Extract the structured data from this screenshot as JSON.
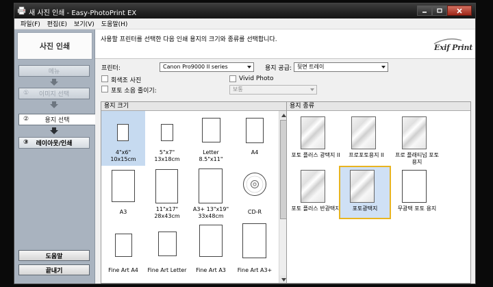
{
  "window": {
    "title": "새 사진 인쇄 - Easy-PhotoPrint EX",
    "app_icon": "printer-app-icon"
  },
  "menu": [
    "파일(F)",
    "편집(E)",
    "보기(V)",
    "도움말(H)"
  ],
  "nav": {
    "title": "사진 인쇄",
    "steps": [
      {
        "label": "메뉴",
        "num": "",
        "state": "disabled"
      },
      {
        "label": "이미지 선택",
        "num": "①",
        "state": "disabled"
      },
      {
        "label": "용지 선택",
        "num": "②",
        "state": "active"
      },
      {
        "label": "레이아웃/인쇄",
        "num": "③",
        "state": "enabled"
      }
    ],
    "help_label": "도움말",
    "exit_label": "끝내기"
  },
  "instruction": {
    "text": "사용할 프린터를 선택한 다음 인쇄 용지의 크기와 종류를 선택합니다.",
    "logo": "Exif Print"
  },
  "settings": {
    "printer_label": "프린터:",
    "printer_value": "Canon Pro9000 II series",
    "paper_source_label": "용지 공급:",
    "paper_source_value": "뒷면 트레이",
    "grayscale_label": "회색조 사진",
    "vivid_label": "Vivid Photo",
    "noise_label": "포토 소음 줄이기:",
    "noise_value": "보통"
  },
  "paper_size": {
    "header": "용지 크기",
    "items": [
      {
        "label1": "4\"x6\"",
        "label2": "10x15cm",
        "selected": true
      },
      {
        "label1": "5\"x7\"",
        "label2": "13x18cm",
        "selected": false
      },
      {
        "label1": "Letter",
        "label2": "8.5\"x11\"",
        "selected": false
      },
      {
        "label1": "A4",
        "label2": "",
        "selected": false
      },
      {
        "label1": "A3",
        "label2": "",
        "selected": false
      },
      {
        "label1": "11\"x17\"",
        "label2": "28x43cm",
        "selected": false
      },
      {
        "label1": "A3+ 13\"x19\"",
        "label2": "33x48cm",
        "selected": false
      },
      {
        "label1": "CD-R",
        "label2": "",
        "selected": false
      },
      {
        "label1": "Fine Art A4",
        "label2": "",
        "selected": false
      },
      {
        "label1": "Fine Art Letter",
        "label2": "",
        "selected": false
      },
      {
        "label1": "Fine Art A3",
        "label2": "",
        "selected": false
      },
      {
        "label1": "Fine Art A3+",
        "label2": "",
        "selected": false
      }
    ]
  },
  "paper_type": {
    "header": "용지 종류",
    "items": [
      {
        "label": "포토 플러스 광택지 II",
        "finish": "glossy",
        "selected": false
      },
      {
        "label": "프로포토용지 II",
        "finish": "glossy",
        "selected": false
      },
      {
        "label": "프로 플래티넘 포토 용지",
        "finish": "glossy",
        "selected": false
      },
      {
        "label": "포토 플러스 반광택지",
        "finish": "glossy",
        "selected": false
      },
      {
        "label": "포토광택지",
        "finish": "glossy",
        "selected": true
      },
      {
        "label": "무광택 포토 용지",
        "finish": "matte",
        "selected": false
      }
    ]
  },
  "colors": {
    "nav_bg": "#a9b3bf",
    "selection": "#c6daf0",
    "selection_border": "#e8b420"
  }
}
